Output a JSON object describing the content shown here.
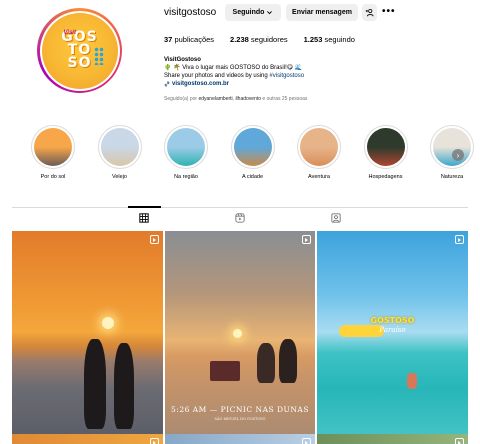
{
  "profile": {
    "username": "visitgostoso",
    "logo_small": "Visit",
    "logo_lines": [
      "GOS",
      "TO",
      "SO"
    ],
    "following_button": "Seguindo",
    "message_button": "Enviar mensagem",
    "add_user_glyph": "+α",
    "more_glyph": "•••",
    "stats": {
      "posts_count": "37",
      "posts_label": "publicações",
      "followers_count": "2.238",
      "followers_label": "seguidores",
      "following_count": "1.253",
      "following_label": "seguindo"
    },
    "bio": {
      "name": "VisitGostoso",
      "line1": "🌵 🌴 Viva o lugar mais GOSTOSO do Brasil!😋 🌊",
      "line2_prefix": "Share your photos and videos by using ",
      "hashtag": "#visitgostoso",
      "link": "visitgostoso.com.br"
    },
    "followed_by": {
      "prefix": "Seguido(a) por ",
      "user1": "edyanelamberti",
      "sep": ", ",
      "user2": "ilhadovento",
      "suffix": " e outras 25 pessoas"
    }
  },
  "highlights": [
    {
      "label": "Por do sol",
      "colors": [
        "#f7a64a",
        "#6b5b57"
      ]
    },
    {
      "label": "Velejo",
      "colors": [
        "#c9d7e6",
        "#d8c7a8"
      ]
    },
    {
      "label": "Na região",
      "colors": [
        "#9ccbe7",
        "#2fb3b2"
      ]
    },
    {
      "label": "A cidade",
      "colors": [
        "#5fa8d9",
        "#c88b4a"
      ]
    },
    {
      "label": "Aventura",
      "colors": [
        "#e7b48a",
        "#d98e5a"
      ]
    },
    {
      "label": "Hospedagens",
      "colors": [
        "#2d3a2c",
        "#b04532"
      ]
    },
    {
      "label": "Natureza",
      "colors": [
        "#e7e2da",
        "#3aa7c9"
      ]
    }
  ],
  "next_arrow": "›",
  "tabs": [
    {
      "name": "posts",
      "icon": "grid-icon",
      "active": true
    },
    {
      "name": "reels",
      "icon": "reels-icon",
      "active": false
    },
    {
      "name": "tagged",
      "icon": "tagged-icon",
      "active": false
    }
  ],
  "posts": {
    "p2_caption": "5:26 AM — PICNIC NAS DUNAS",
    "p2_sub": "SÃO MIGUEL DO GOSTOSO",
    "p3_title": "GOSTOSO",
    "p3_sub": "Paraíso"
  }
}
